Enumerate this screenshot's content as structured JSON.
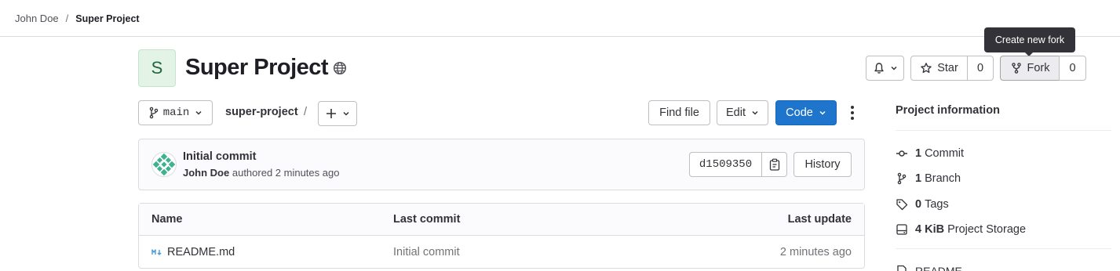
{
  "breadcrumb": {
    "user": "John Doe",
    "separator": "/",
    "project": "Super Project"
  },
  "tooltip": {
    "text": "Create new fork"
  },
  "project": {
    "avatar_letter": "S",
    "title": "Super Project",
    "visibility_icon": "globe-icon"
  },
  "actions": {
    "notification_icon": "bell-icon",
    "star_label": "Star",
    "star_count": "0",
    "fork_label": "Fork",
    "fork_count": "0"
  },
  "repo_nav": {
    "branch": "main",
    "path": "super-project",
    "path_separator": "/",
    "add_icon": "plus-icon",
    "find_file": "Find file",
    "edit": "Edit",
    "code": "Code"
  },
  "last_commit": {
    "title": "Initial commit",
    "author": "John Doe",
    "meta": "authored 2 minutes ago",
    "sha": "d1509350",
    "history": "History"
  },
  "files_table": {
    "headers": [
      "Name",
      "Last commit",
      "Last update"
    ],
    "rows": [
      {
        "name": "README.md",
        "last_commit": "Initial commit",
        "last_update": "2 minutes ago",
        "icon": "markdown-icon"
      }
    ]
  },
  "sidebar": {
    "title": "Project information",
    "items": [
      {
        "icon": "commit-icon",
        "count": "1",
        "label": "Commit"
      },
      {
        "icon": "branch-icon",
        "count": "1",
        "label": "Branch"
      },
      {
        "icon": "tag-icon",
        "count": "0",
        "label": "Tags"
      },
      {
        "icon": "storage-icon",
        "count": "4 KiB",
        "label": "Project Storage"
      }
    ],
    "readme": "README"
  },
  "colors": {
    "primary": "#1f75cb",
    "avatar_bg": "#e3f3e5",
    "tooltip_bg": "#333238"
  }
}
